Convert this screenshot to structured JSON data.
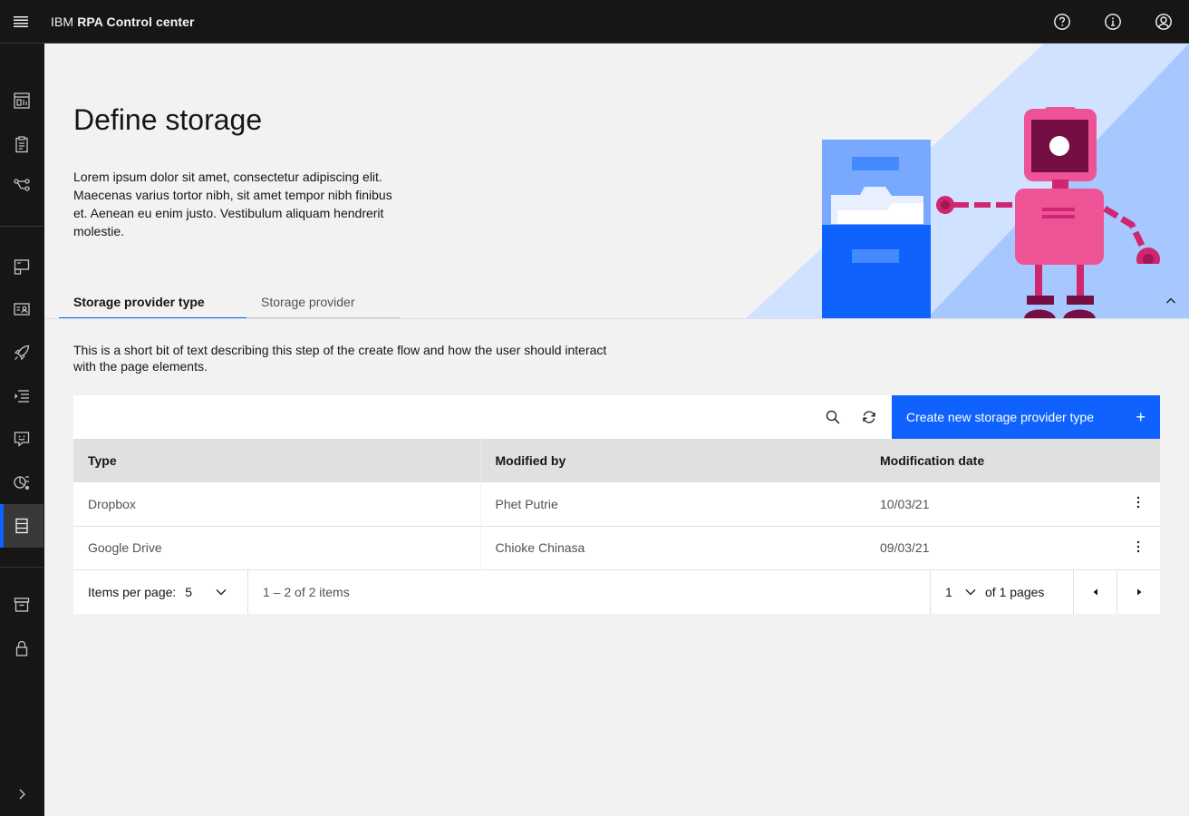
{
  "header": {
    "brand_prefix": "IBM",
    "brand_name": "RPA Control center",
    "actions": [
      "help-icon",
      "info-icon",
      "user-avatar-icon"
    ]
  },
  "sidenav": {
    "items": [
      "dashboard-icon",
      "clipboard-icon",
      "workflow-icon",
      "computer-icon",
      "credentials-icon",
      "rocket-icon",
      "list-icon",
      "chat-bot-icon",
      "analytics-icon",
      "storage-icon",
      "archive-icon",
      "lock-icon",
      "expand-icon"
    ],
    "active": "storage-icon"
  },
  "hero": {
    "title": "Define storage",
    "description": "Lorem ipsum dolor sit amet, consectetur adipiscing elit. Maecenas varius tortor nibh, sit amet tempor nibh finibus et. Aenean eu enim justo. Vestibulum aliquam hendrerit molestie."
  },
  "tabs": {
    "items": [
      "Storage provider type",
      "Storage provider"
    ],
    "active_index": 0
  },
  "step_description": "This is a short bit of text describing this step of the create flow and how the user should interact with the page elements.",
  "toolbar": {
    "primary_label": "Create new storage provider type",
    "primary_icon": "+"
  },
  "table": {
    "headers": [
      "Type",
      "Modified by",
      "Modification date"
    ],
    "rows": [
      {
        "type": "Dropbox",
        "modified_by": "Phet Putrie",
        "date": "10/03/21"
      },
      {
        "type": "Google Drive",
        "modified_by": "Chioke Chinasa",
        "date": "09/03/21"
      }
    ]
  },
  "pagination": {
    "items_per_page_label": "Items per page:",
    "items_per_page_value": "5",
    "range_text": "1 – 2 of 2 items",
    "page_value": "1",
    "page_total_text": "of 1 pages"
  },
  "colors": {
    "accent": "#0f62fe",
    "header_bg": "#161616",
    "robot_pink": "#ee5396",
    "robot_dark": "#9f1853",
    "illustration_light_blue": "#d0e2ff",
    "illustration_mid_blue": "#a6c8ff"
  }
}
